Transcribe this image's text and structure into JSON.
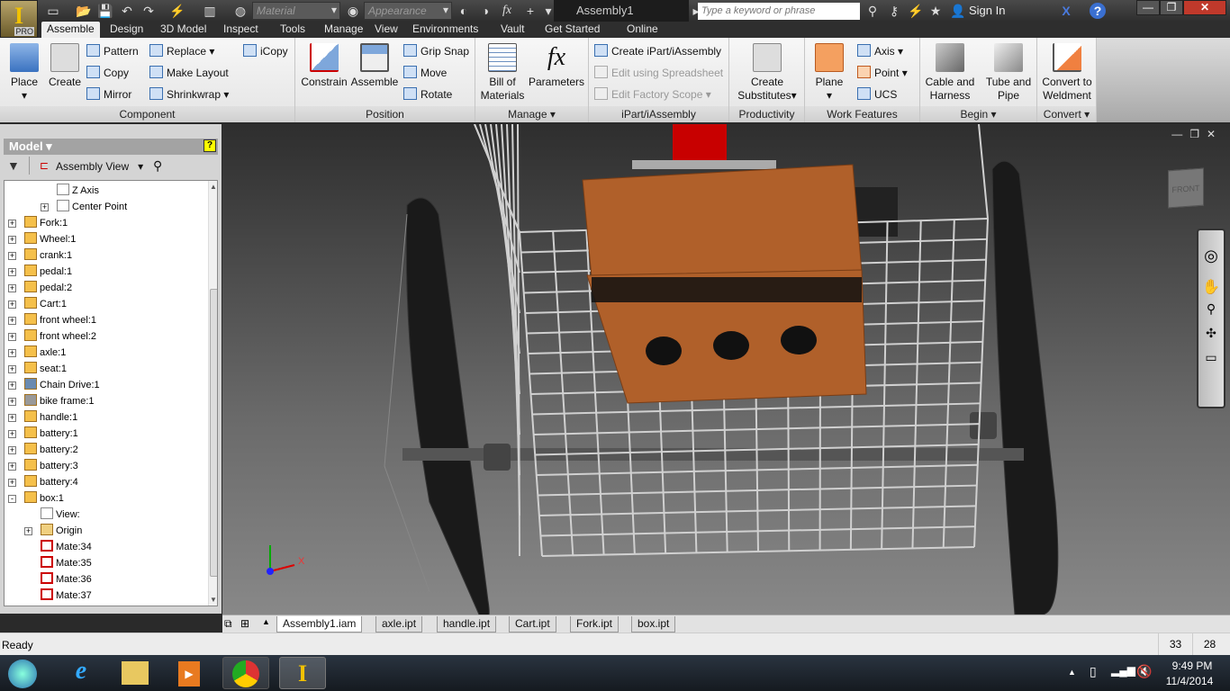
{
  "app": {
    "badge": "PRO",
    "doc_title": "Assembly1",
    "search_placeholder": "Type a keyword or phrase",
    "sign_in": "Sign In",
    "material": "Material",
    "appearance": "Appearance"
  },
  "tabs": [
    "Assemble",
    "Design",
    "3D Model",
    "Inspect",
    "Tools",
    "Manage",
    "View",
    "Environments",
    "Vault",
    "Get Started",
    "Online"
  ],
  "ribbon": {
    "component": {
      "label": "Component",
      "place": "Place",
      "create": "Create",
      "pattern": "Pattern",
      "copy": "Copy",
      "mirror": "Mirror",
      "replace": "Replace",
      "make_layout": "Make Layout",
      "shrinkwrap": "Shrinkwrap",
      "icopy": "iCopy"
    },
    "position": {
      "label": "Position",
      "constrain": "Constrain",
      "assemble": "Assemble",
      "grip_snap": "Grip Snap",
      "move": "Move",
      "rotate": "Rotate"
    },
    "manage": {
      "label": "Manage",
      "bom1": "Bill of",
      "bom2": "Materials",
      "parameters": "Parameters"
    },
    "ipart": {
      "label": "iPart/iAssembly",
      "create": "Create iPart/iAssembly",
      "edit_spreadsheet": "Edit using Spreadsheet",
      "edit_factory": "Edit Factory Scope"
    },
    "productivity": {
      "label": "Productivity",
      "cs1": "Create",
      "cs2": "Substitutes"
    },
    "work": {
      "label": "Work Features",
      "plane": "Plane",
      "axis": "Axis",
      "point": "Point",
      "ucs": "UCS"
    },
    "begin": {
      "label": "Begin",
      "cable1": "Cable and",
      "cable2": "Harness",
      "tube1": "Tube and",
      "tube2": "Pipe"
    },
    "convert": {
      "label": "Convert",
      "w1": "Convert to",
      "w2": "Weldment"
    }
  },
  "browser": {
    "title": "Model",
    "view": "Assembly View",
    "tree": [
      {
        "label": "Z Axis",
        "level": 2,
        "icon": "axis"
      },
      {
        "label": "Center Point",
        "level": 2,
        "icon": "point",
        "exp": "+"
      },
      {
        "label": "Fork:1",
        "level": 0,
        "icon": "part",
        "exp": "+"
      },
      {
        "label": "Wheel:1",
        "level": 0,
        "icon": "part",
        "exp": "+"
      },
      {
        "label": "crank:1",
        "level": 0,
        "icon": "part",
        "exp": "+"
      },
      {
        "label": "pedal:1",
        "level": 0,
        "icon": "part",
        "exp": "+"
      },
      {
        "label": "pedal:2",
        "level": 0,
        "icon": "part",
        "exp": "+"
      },
      {
        "label": "Cart:1",
        "level": 0,
        "icon": "part",
        "exp": "+"
      },
      {
        "label": "front wheel:1",
        "level": 0,
        "icon": "part",
        "exp": "+"
      },
      {
        "label": "front wheel:2",
        "level": 0,
        "icon": "part",
        "exp": "+"
      },
      {
        "label": "axle:1",
        "level": 0,
        "icon": "part",
        "exp": "+"
      },
      {
        "label": "seat:1",
        "level": 0,
        "icon": "part",
        "exp": "+"
      },
      {
        "label": "Chain Drive:1",
        "level": 0,
        "icon": "chain",
        "exp": "+"
      },
      {
        "label": "bike frame:1",
        "level": 0,
        "icon": "frame",
        "exp": "+"
      },
      {
        "label": "handle:1",
        "level": 0,
        "icon": "part",
        "exp": "+"
      },
      {
        "label": "battery:1",
        "level": 0,
        "icon": "part",
        "exp": "+"
      },
      {
        "label": "battery:2",
        "level": 0,
        "icon": "part",
        "exp": "+"
      },
      {
        "label": "battery:3",
        "level": 0,
        "icon": "part",
        "exp": "+"
      },
      {
        "label": "battery:4",
        "level": 0,
        "icon": "part",
        "exp": "+"
      },
      {
        "label": "box:1",
        "level": 0,
        "icon": "part",
        "exp": "-"
      },
      {
        "label": "View:",
        "level": 1,
        "icon": "view"
      },
      {
        "label": "Origin",
        "level": 1,
        "icon": "folder",
        "exp": "+"
      },
      {
        "label": "Mate:34",
        "level": 1,
        "icon": "mate"
      },
      {
        "label": "Mate:35",
        "level": 1,
        "icon": "mate"
      },
      {
        "label": "Mate:36",
        "level": 1,
        "icon": "mate"
      },
      {
        "label": "Mate:37",
        "level": 1,
        "icon": "mate"
      }
    ]
  },
  "viewport": {
    "viewcube_face": "FRONT",
    "axis_x": "X"
  },
  "doc_tabs": [
    "Assembly1.iam",
    "axle.ipt",
    "handle.ipt",
    "Cart.ipt",
    "Fork.ipt",
    "box.ipt"
  ],
  "status": {
    "text": "Ready",
    "val1": "33",
    "val2": "28"
  },
  "taskbar": {
    "time": "9:49 PM",
    "date": "11/4/2014"
  },
  "colors": {
    "box": "#b0602a",
    "accent": "#f2c200"
  }
}
